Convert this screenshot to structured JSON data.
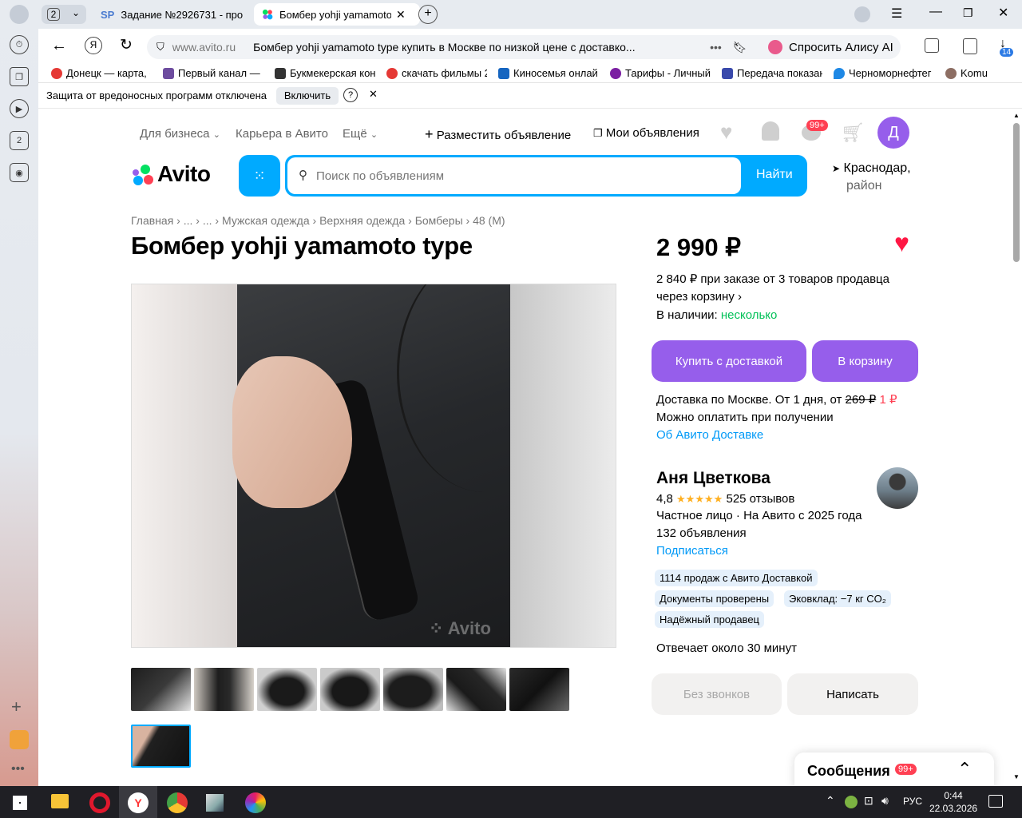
{
  "browser": {
    "tab_count": "2",
    "tabs": [
      {
        "favicon": "SP",
        "title": "Задание №2926731 - про"
      },
      {
        "title": "Бомбер yohji yamamoto"
      }
    ],
    "address": {
      "domain": "www.avito.ru",
      "page_title": "Бомбер yohji yamamoto type купить в Москве по низкой цене с доставко..."
    },
    "alice_label": "Спросить Алису AI",
    "downloads_badge": "14",
    "rail_badge": "2",
    "bookmarks": [
      {
        "label": "Донецк — карта, с",
        "color": "#e53935"
      },
      {
        "label": "Первый канал — с",
        "color": "#6d4c9f"
      },
      {
        "label": "Букмекерская кон",
        "color": "#333333"
      },
      {
        "label": "скачать фильмы 2",
        "color": "#e53935"
      },
      {
        "label": "Киносемья онлай",
        "color": "#1565c0"
      },
      {
        "label": "Тарифы - Личный",
        "color": "#7b1fa2"
      },
      {
        "label": "Передача показан",
        "color": "#3949ab"
      },
      {
        "label": "Черноморнефтег",
        "color": "#1e88e5"
      },
      {
        "label": "Komu",
        "color": "#8d6e63"
      }
    ],
    "protection": {
      "text": "Защита от вредоносных программ отключена",
      "enable": "Включить",
      "help": "?"
    }
  },
  "site": {
    "top_nav": {
      "business": "Для бизнеса",
      "career": "Карьера в Авито",
      "more": "Ещё",
      "post_ad": "Разместить объявление",
      "my_ads": "Мои объявления",
      "messages_badge": "99+",
      "avatar_letter": "Д"
    },
    "logo": "Avito",
    "search": {
      "placeholder": "Поиск по объявлениям",
      "button": "Найти"
    },
    "location": {
      "line1": "Краснодар,",
      "line2": "район"
    },
    "breadcrumbs": [
      "Главная",
      "...",
      "...",
      "Мужская одежда",
      "Верхняя одежда",
      "Бомберы",
      "48 (M)"
    ],
    "title": "Бомбер yohji yamamoto type",
    "watermark": "Avito",
    "price": {
      "main": "2 990 ₽",
      "bulk_line1": "2 840 ₽ при заказе от 3 товаров продавца",
      "bulk_line2": "через корзину",
      "stock_label": "В наличии:",
      "stock_value": "несколько"
    },
    "buttons": {
      "buy": "Купить с доставкой",
      "cart": "В корзину",
      "no_calls": "Без звонков",
      "write": "Написать"
    },
    "delivery": {
      "line1_prefix": "Доставка по Москве. От 1 дня, от",
      "old_price": "269 ₽",
      "new_price": "1 ₽",
      "line2": "Можно оплатить при получении",
      "link": "Об Авито Доставке"
    },
    "seller": {
      "name": "Аня Цветкова",
      "rating": "4,8",
      "stars": "★★★★★",
      "reviews": "525 отзывов",
      "type": "Частное лицо · На Авито с 2025 года",
      "ads": "132 объявления",
      "subscribe": "Подписаться",
      "badges": [
        "1114 продаж с Авито Доставкой",
        "Документы проверены",
        "Эковклад: −7 кг CO₂",
        "Надёжный продавец"
      ],
      "response": "Отвечает около 30 минут"
    },
    "messages_panel": {
      "label": "Сообщения",
      "badge": "99+"
    }
  },
  "taskbar": {
    "lang": "РУС",
    "time": "0:44",
    "date": "22.03.2026"
  },
  "colors": {
    "accent_purple": "#965eeb",
    "avito_blue": "#00aaff",
    "link_blue": "#0099f7",
    "green": "#02d15c",
    "heart_red": "#ff1744"
  }
}
